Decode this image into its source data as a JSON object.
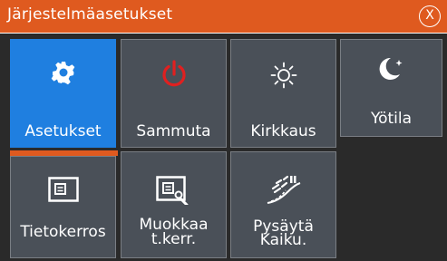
{
  "window": {
    "title": "Järjestelmäasetukset",
    "close_symbol": "X"
  },
  "tiles": [
    {
      "id": "asetukset",
      "label": "Asetukset",
      "icon": "gear-icon",
      "selected": true
    },
    {
      "id": "sammuta",
      "label": "Sammuta",
      "icon": "power-icon"
    },
    {
      "id": "kirkkaus",
      "label": "Kirkkaus",
      "icon": "sun-icon"
    },
    {
      "id": "yotila",
      "label": "Yötila",
      "icon": "moon-icon"
    },
    {
      "id": "tietokerros",
      "label": "Tietokerros",
      "icon": "data-overlay-icon"
    },
    {
      "id": "muokkaa",
      "label_line1": "Muokkaa",
      "label_line2": "t.kerr.",
      "icon": "edit-overlay-icon"
    },
    {
      "id": "pysayta",
      "label_line1": "Pysäytä",
      "label_line2": "Kaiku.",
      "icon": "pause-echo-icon"
    }
  ],
  "colors": {
    "accent": "#df5a1f",
    "selected": "#1f7fe0",
    "tile": "#4a5058",
    "power": "#e02020"
  }
}
